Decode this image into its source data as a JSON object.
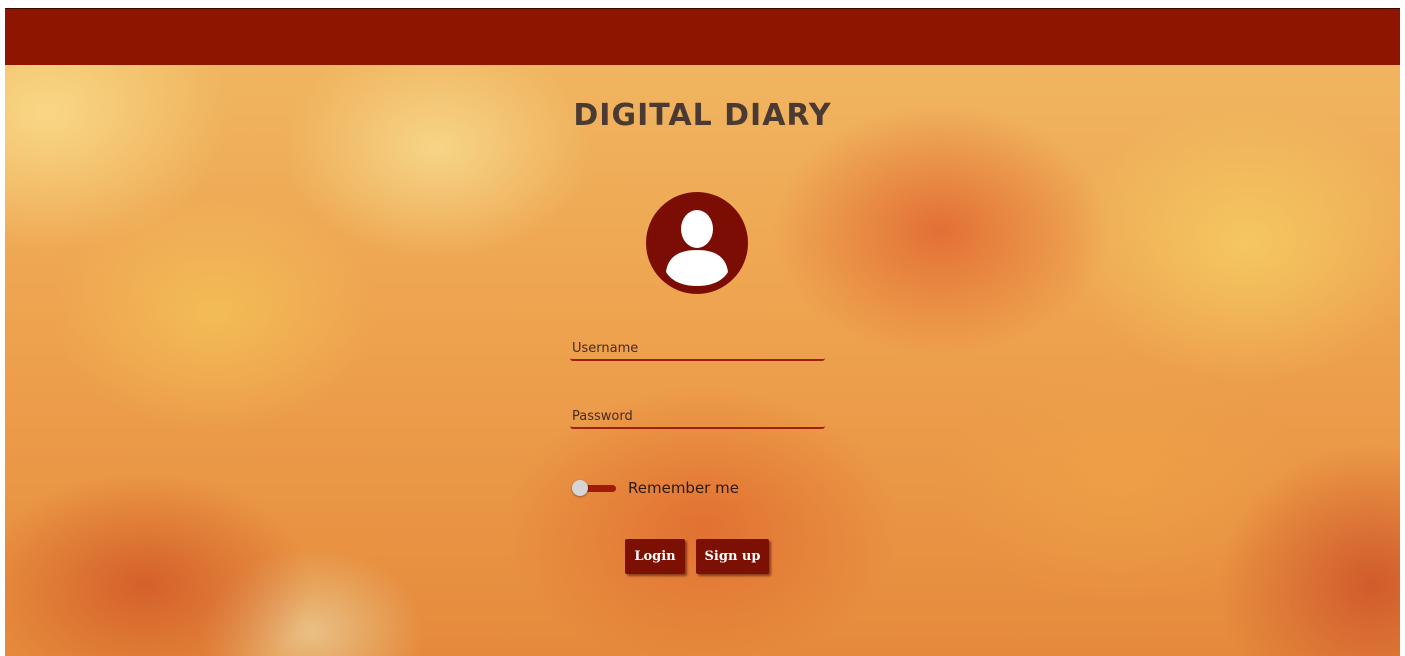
{
  "app": {
    "title": "DIGITAL DIARY"
  },
  "avatar": {
    "icon": "user-icon"
  },
  "form": {
    "username": {
      "placeholder": "Username",
      "value": ""
    },
    "password": {
      "placeholder": "Password",
      "value": ""
    },
    "remember": {
      "label": "Remember me",
      "checked": false
    }
  },
  "buttons": {
    "login_label": "Login",
    "signup_label": "Sign up"
  },
  "colors": {
    "header_bar": "#8e1500",
    "accent": "#7d1004",
    "title_text": "#4a3a33"
  }
}
